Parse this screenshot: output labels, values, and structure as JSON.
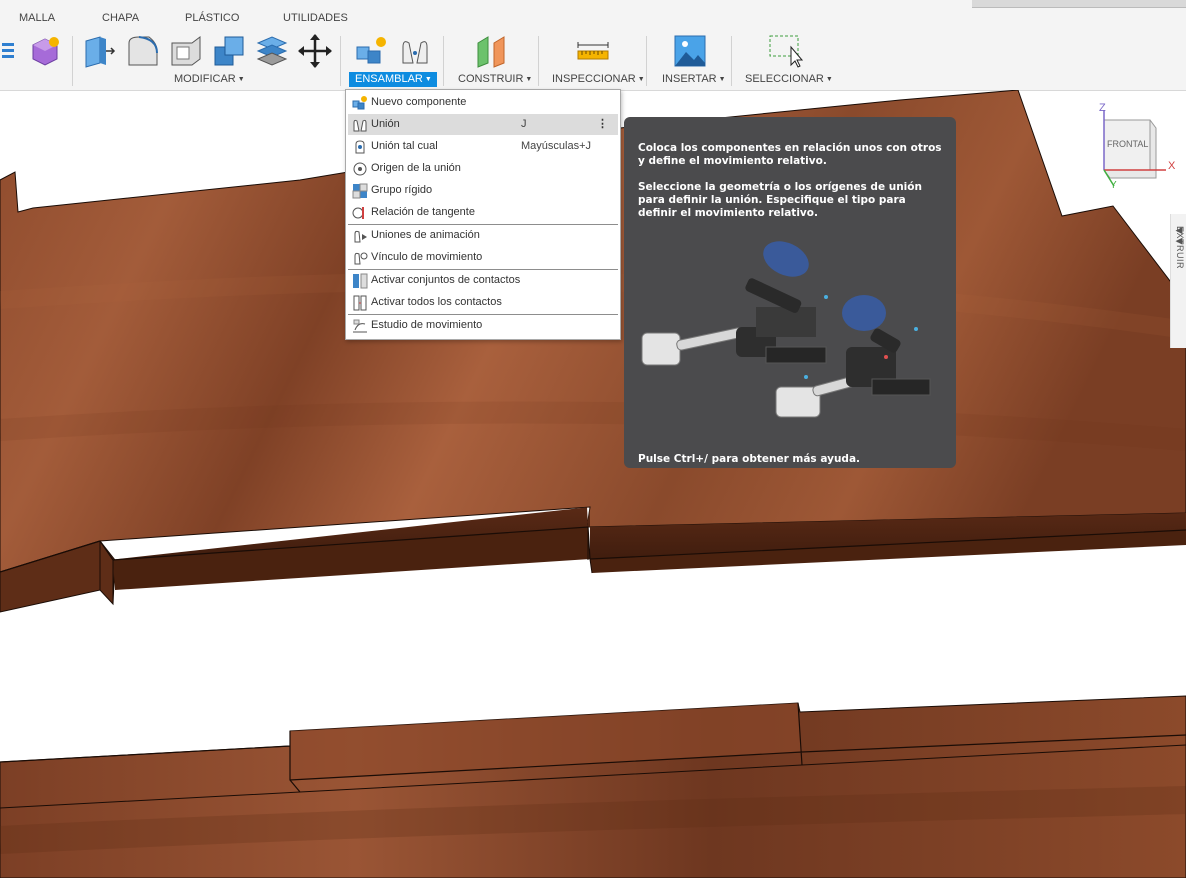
{
  "tabs": [
    "MALLA",
    "CHAPA",
    "PLÁSTICO",
    "UTILIDADES"
  ],
  "groups": {
    "modificar": "MODIFICAR",
    "ensamblar": "ENSAMBLAR",
    "construir": "CONSTRUIR",
    "inspeccionar": "INSPECCIONAR",
    "insertar": "INSERTAR",
    "seleccionar": "SELECCIONAR"
  },
  "menu": {
    "items": [
      {
        "label": "Nuevo componente",
        "shortcut": "",
        "icon": "new-component-icon"
      },
      {
        "label": "Unión",
        "shortcut": "J",
        "icon": "joint-icon",
        "highlighted": true
      },
      {
        "label": "Unión tal cual",
        "shortcut": "Mayúsculas+J",
        "icon": "as-built-joint-icon"
      },
      {
        "label": "Origen de la unión",
        "shortcut": "",
        "icon": "joint-origin-icon"
      },
      {
        "label": "Grupo rígido",
        "shortcut": "",
        "icon": "rigid-group-icon"
      },
      {
        "label": "Relación de tangente",
        "shortcut": "",
        "icon": "tangent-relationship-icon"
      },
      {
        "label": "Uniones de animación",
        "shortcut": "",
        "icon": "animate-joints-icon"
      },
      {
        "label": "Vínculo de movimiento",
        "shortcut": "",
        "icon": "motion-link-icon"
      },
      {
        "label": "Activar conjuntos de contactos",
        "shortcut": "",
        "icon": "contact-sets-icon"
      },
      {
        "label": "Activar todos los contactos",
        "shortcut": "",
        "icon": "all-contacts-icon"
      },
      {
        "label": "Estudio de movimiento",
        "shortcut": "",
        "icon": "motion-study-icon"
      }
    ]
  },
  "tooltip": {
    "p1": "Coloca los componentes en relación unos con otros y define el movimiento relativo.",
    "p2": "Seleccione la geometría o los orígenes de unión para definir la unión. Especifique el tipo para definir el movimiento relativo.",
    "footer": "Pulse Ctrl+/ para obtener más ayuda."
  },
  "viewcube": {
    "face": "FRONTAL",
    "axis_x": "X",
    "axis_y": "Y",
    "axis_z": "Z"
  },
  "side_panel": {
    "label": "EXTRUIR"
  },
  "colors": {
    "accent": "#0e8ce0",
    "wood": "#8a4a2c",
    "tooltip_bg": "#4b4b4d"
  }
}
